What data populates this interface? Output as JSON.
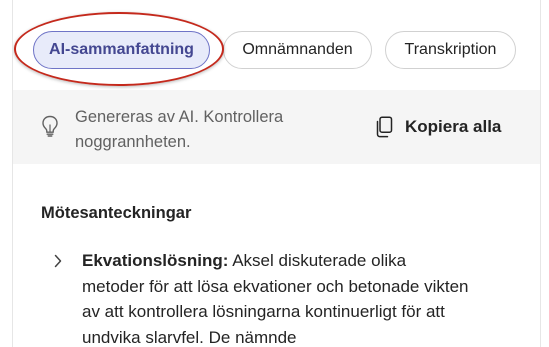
{
  "tabs": [
    {
      "label": "AI-sammanfattning",
      "active": true
    },
    {
      "label": "Omnämnanden",
      "active": false
    },
    {
      "label": "Transkription",
      "active": false
    }
  ],
  "notice": {
    "icon": "lightbulb-icon",
    "text": "Genereras av AI. Kontrollera noggrannheten.",
    "copy_label": "Kopiera alla",
    "copy_icon": "copy-icon"
  },
  "notes": {
    "section_title": "Mötesanteckningar",
    "items": [
      {
        "title": "Ekvationslösning:",
        "text": " Aksel diskuterade olika metoder för att lösa ekvationer och betonade vikten av att kontrollera lösningarna kontinuerligt för att undvika slarvfel. De nämnde"
      }
    ]
  },
  "colors": {
    "active_tab_bg": "#e8ebfa",
    "active_tab_text": "#444791",
    "highlight_ring": "#c4291c",
    "notice_bg": "#f5f5f5"
  }
}
